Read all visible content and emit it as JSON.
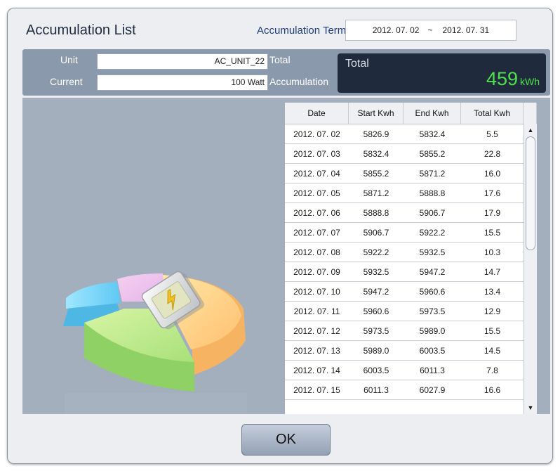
{
  "dialog": {
    "title": "Accumulation List",
    "term_label": "Accumulation Term",
    "term_start": "2012. 07. 02",
    "term_separator": "~",
    "term_end": "2012. 07. 31"
  },
  "info": {
    "unit_label": "Unit",
    "unit_value": "AC_UNIT_22",
    "current_label": "Current",
    "current_value": "100  Watt",
    "total_label_line1": "Total",
    "total_label_line2": "Accumulation",
    "total_box_title": "Total",
    "total_value": "459",
    "total_unit": "kWh",
    "total_color": "#4ee04c"
  },
  "chart_icon": "pie-chart-with-energy-card-icon",
  "table": {
    "headers": [
      "Date",
      "Start Kwh",
      "End Kwh",
      "Total Kwh"
    ],
    "rows": [
      [
        "2012. 07. 02",
        "5826.9",
        "5832.4",
        "5.5"
      ],
      [
        "2012. 07. 03",
        "5832.4",
        "5855.2",
        "22.8"
      ],
      [
        "2012. 07. 04",
        "5855.2",
        "5871.2",
        "16.0"
      ],
      [
        "2012. 07. 05",
        "5871.2",
        "5888.8",
        "17.6"
      ],
      [
        "2012. 07. 06",
        "5888.8",
        "5906.7",
        "17.9"
      ],
      [
        "2012. 07. 07",
        "5906.7",
        "5922.2",
        "15.5"
      ],
      [
        "2012. 07. 08",
        "5922.2",
        "5932.5",
        "10.3"
      ],
      [
        "2012. 07. 09",
        "5932.5",
        "5947.2",
        "14.7"
      ],
      [
        "2012. 07. 10",
        "5947.2",
        "5960.6",
        "13.4"
      ],
      [
        "2012. 07. 11",
        "5960.6",
        "5973.5",
        "12.9"
      ],
      [
        "2012. 07. 12",
        "5973.5",
        "5989.0",
        "15.5"
      ],
      [
        "2012. 07. 13",
        "5989.0",
        "6003.5",
        "14.5"
      ],
      [
        "2012. 07. 14",
        "6003.5",
        "6011.3",
        "7.8"
      ],
      [
        "2012. 07. 15",
        "6011.3",
        "6027.9",
        "16.6"
      ]
    ]
  },
  "buttons": {
    "ok_label": "OK"
  }
}
